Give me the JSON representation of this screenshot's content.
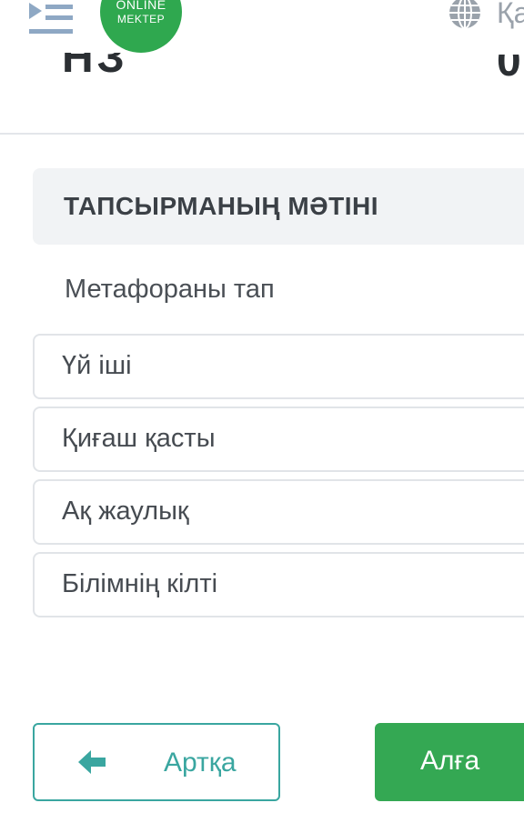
{
  "header": {
    "logo_line1": "ONLINE",
    "logo_line2": "MEKTEP",
    "lang_label": "Қа",
    "left_fragment": "НЗ",
    "right_fragment": "0",
    "icons": [
      "menu-icon",
      "globe-icon"
    ],
    "brand_color": "#2fa84f"
  },
  "task": {
    "section_title": "ТАПСЫРМАНЫҢ МӘТІНІ",
    "question": "Метафораны тап",
    "options": [
      {
        "label": "Үй іші"
      },
      {
        "label": "Қиғаш қасты"
      },
      {
        "label": "Ақ жаулық"
      },
      {
        "label": "Білімнің кілті"
      }
    ]
  },
  "footer": {
    "back_label": "Артқа",
    "next_label": "Алға",
    "back_color": "#3aa6a0",
    "next_color": "#34a853"
  }
}
